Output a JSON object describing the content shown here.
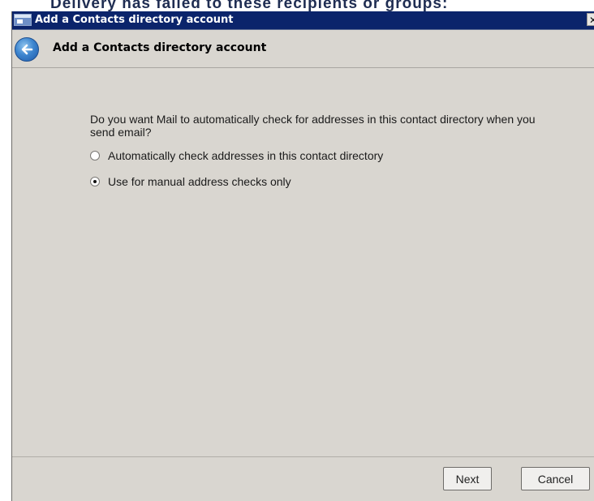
{
  "background": {
    "behind_text": "Delivery has failed to these recipients or groups:"
  },
  "window": {
    "title": "Add a Contacts directory account",
    "close_symbol": "✕"
  },
  "header": {
    "title": "Add a Contacts directory account",
    "back_icon": "back-arrow-icon"
  },
  "content": {
    "question": "Do you want Mail to automatically check for addresses in this contact directory when you send email?",
    "options": [
      {
        "label": "Automatically check addresses in this contact directory",
        "selected": false
      },
      {
        "label": "Use for manual address checks only",
        "selected": true
      }
    ]
  },
  "buttons": {
    "next": "Next",
    "cancel": "Cancel"
  },
  "colors": {
    "titlebar": "#0b246b",
    "window_bg": "#d9d6d0",
    "back_button": "#3e86cf"
  }
}
